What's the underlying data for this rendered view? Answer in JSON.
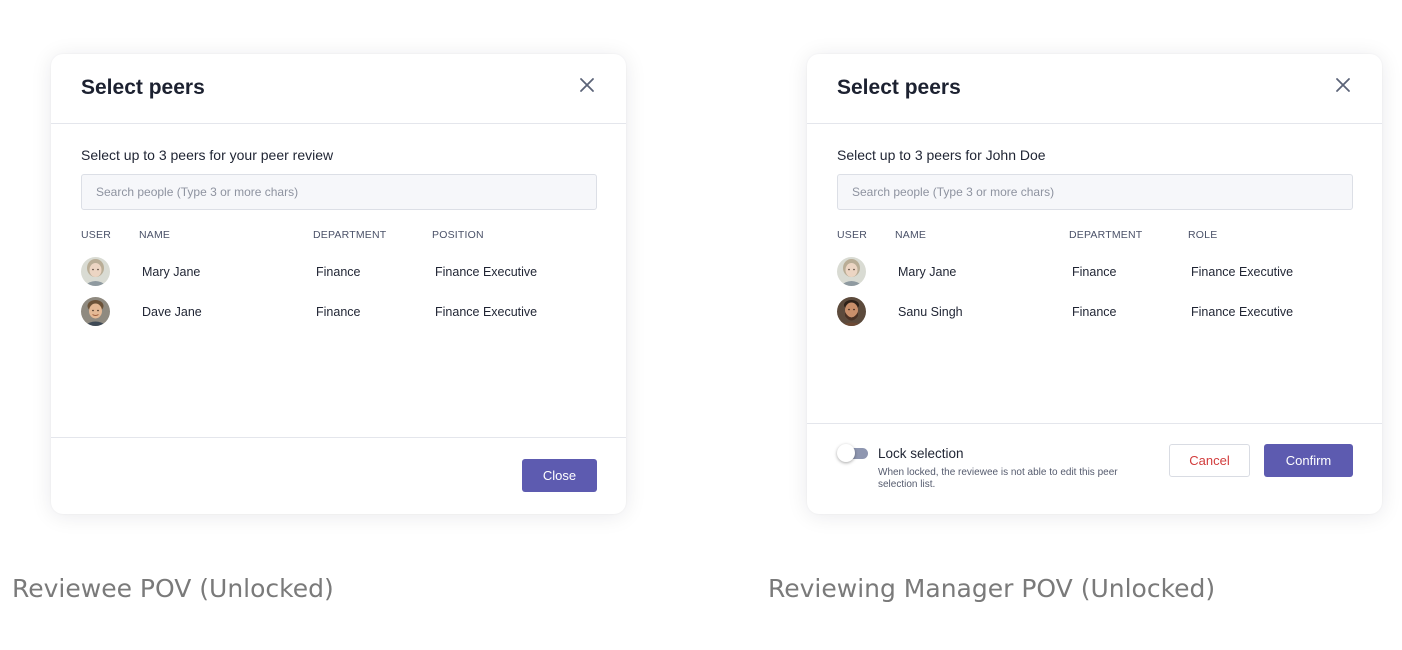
{
  "left_modal": {
    "title": "Select peers",
    "subtitle": "Select up to 3 peers for your peer review",
    "search_placeholder": "Search people (Type 3 or more chars)",
    "columns": [
      "USER",
      "NAME",
      "DEPARTMENT",
      "POSITION"
    ],
    "rows": [
      {
        "avatar": "female-avatar",
        "name": "Mary Jane",
        "department": "Finance",
        "position": "Finance Executive"
      },
      {
        "avatar": "male-avatar",
        "name": "Dave Jane",
        "department": "Finance",
        "position": "Finance Executive"
      }
    ],
    "close_button": "Close"
  },
  "right_modal": {
    "title": "Select peers",
    "subtitle": "Select up to 3 peers for John Doe",
    "search_placeholder": "Search people (Type 3 or more chars)",
    "columns": [
      "USER",
      "NAME",
      "DEPARTMENT",
      "ROLE"
    ],
    "rows": [
      {
        "avatar": "female-avatar",
        "name": "Mary Jane",
        "department": "Finance",
        "position": "Finance Executive"
      },
      {
        "avatar": "male-bearded-avatar",
        "name": "Sanu Singh",
        "department": "Finance",
        "position": "Finance Executive"
      }
    ],
    "lock_label": "Lock selection",
    "lock_description": "When locked, the reviewee is not able to edit this peer selection list.",
    "lock_enabled": false,
    "cancel_button": "Cancel",
    "confirm_button": "Confirm"
  },
  "captions": {
    "left": "Reviewee POV (Unlocked)",
    "right": "Reviewing Manager POV (Unlocked)"
  },
  "colors": {
    "primary": "#5d5bb0",
    "danger_text": "#d23c3c",
    "toggle_off": "#8e96b0"
  }
}
